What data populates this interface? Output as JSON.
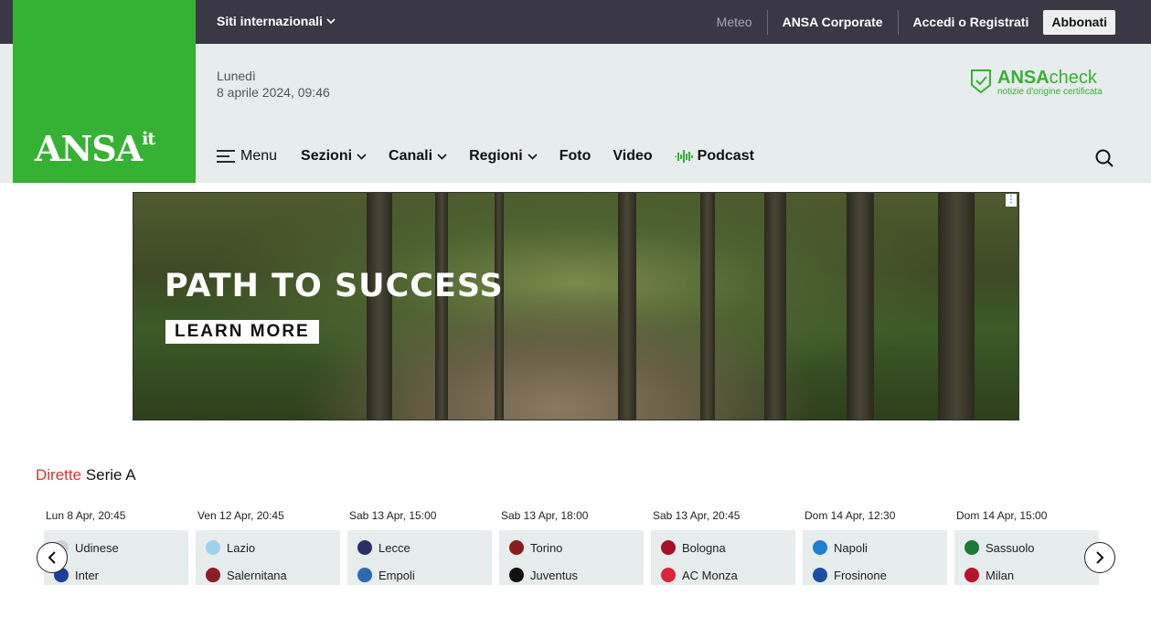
{
  "topbar": {
    "international": "Siti internazionali",
    "meteo": "Meteo",
    "corporate": "ANSA Corporate",
    "login": "Accedi o Registrati",
    "subscribe": "Abbonati"
  },
  "logo": {
    "main": "ANSA",
    "suffix": "it"
  },
  "date": {
    "weekday": "Lunedì",
    "datetime": "8 aprile 2024, 09:46"
  },
  "check": {
    "brand": "ANSA",
    "brand_suffix": "check",
    "tagline": "notizie d'origine certificata",
    "color": "#35b233"
  },
  "nav": {
    "menu": "Menu",
    "sections": "Sezioni",
    "channels": "Canali",
    "regions": "Regioni",
    "photo": "Foto",
    "video": "Video",
    "podcast": "Podcast"
  },
  "ad": {
    "title": "PATH TO SUCCESS",
    "cta": "LEARN MORE"
  },
  "live": {
    "title_red": "Dirette",
    "title_rest": "Serie A",
    "matches": [
      {
        "when": "Lun 8 Apr, 20:45",
        "home": "Udinese",
        "away": "Inter",
        "home_color": "#d0d0d0",
        "away_color": "#1d3e9c"
      },
      {
        "when": "Ven 12 Apr, 20:45",
        "home": "Lazio",
        "away": "Salernitana",
        "home_color": "#9fd1ef",
        "away_color": "#8a1f2a"
      },
      {
        "when": "Sab 13 Apr, 15:00",
        "home": "Lecce",
        "away": "Empoli",
        "home_color": "#2a2f6a",
        "away_color": "#2a6ab0"
      },
      {
        "when": "Sab 13 Apr, 18:00",
        "home": "Torino",
        "away": "Juventus",
        "home_color": "#8b1c1c",
        "away_color": "#111111"
      },
      {
        "when": "Sab 13 Apr, 20:45",
        "home": "Bologna",
        "away": "AC Monza",
        "home_color": "#a5102a",
        "away_color": "#d9263b"
      },
      {
        "when": "Dom 14 Apr, 12:30",
        "home": "Napoli",
        "away": "Frosinone",
        "home_color": "#1f7fd1",
        "away_color": "#1a4fa0"
      },
      {
        "when": "Dom 14 Apr, 15:00",
        "home": "Sassuolo",
        "away": "Milan",
        "home_color": "#1a7a3a",
        "away_color": "#b8122b"
      }
    ]
  },
  "colors": {
    "topbar": "#3b3846",
    "brand_green": "#35b233",
    "header_bg": "#e7eced",
    "accent_red": "#e0302d"
  }
}
